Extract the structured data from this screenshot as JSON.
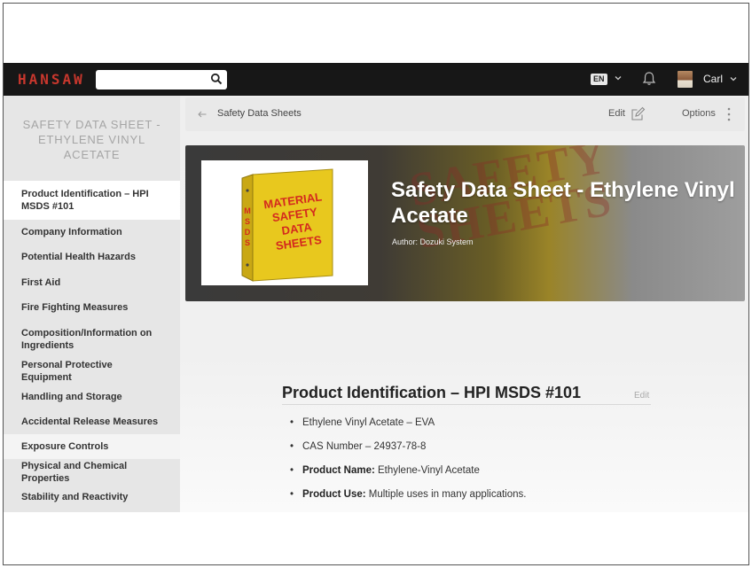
{
  "header": {
    "logo": "HANSAW",
    "search": {
      "value": "",
      "placeholder": ""
    },
    "language": "EN",
    "user_name": "Carl"
  },
  "sidebar": {
    "title": "SAFETY DATA SHEET - ETHYLENE VINYL ACETATE",
    "items": [
      {
        "label": "Product Identification – HPI MSDS #101",
        "active": true
      },
      {
        "label": "Company Information"
      },
      {
        "label": "Potential Health Hazards"
      },
      {
        "label": "First Aid"
      },
      {
        "label": "Fire Fighting Measures"
      },
      {
        "label": "Composition/Information on Ingredients"
      },
      {
        "label": "Personal Protective Equipment"
      },
      {
        "label": "Handling and Storage"
      },
      {
        "label": "Accidental Release Measures"
      },
      {
        "label": "Exposure Controls",
        "hover": true
      },
      {
        "label": "Physical and Chemical Properties"
      },
      {
        "label": "Stability and Reactivity"
      }
    ]
  },
  "toolbar": {
    "breadcrumb": "Safety Data Sheets",
    "edit_label": "Edit",
    "options_label": "Options"
  },
  "hero": {
    "title": "Safety Data Sheet - Ethylene Vinyl Acetate",
    "author": "Author: Dozuki System",
    "background_text": "SAFETY SHEETS",
    "image": {
      "spine_text": "MSDS",
      "cover_lines": [
        "MATERIAL",
        "SAFETY",
        "DATA",
        "SHEETS"
      ]
    }
  },
  "section": {
    "title": "Product Identification – HPI MSDS #101",
    "edit_label": "Edit",
    "bullets": [
      {
        "label": "",
        "text": "Ethylene Vinyl Acetate – EVA"
      },
      {
        "label": "",
        "text": "CAS Number – 24937-78-8"
      },
      {
        "label": "Product Name:",
        "text": " Ethylene-Vinyl Acetate"
      },
      {
        "label": "Product Use:",
        "text": " Multiple uses in many applications."
      }
    ]
  },
  "colors": {
    "topbar": "#171717",
    "logo": "#c8372d",
    "binder_yellow": "#e8c81e",
    "binder_text": "#d42a1e"
  },
  "icons": [
    "search-icon",
    "chevron-down-icon",
    "bell-icon",
    "back-arrow-icon",
    "edit-pencil-icon",
    "kebab-menu-icon"
  ]
}
